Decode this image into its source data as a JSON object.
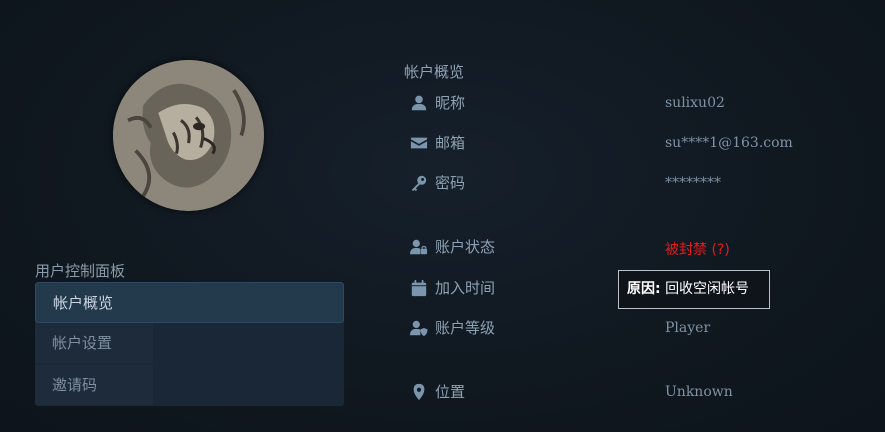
{
  "sidebar": {
    "panel_title": "用户控制面板",
    "items": [
      {
        "label": "帐户概览",
        "active": true
      },
      {
        "label": "帐户设置",
        "active": false
      },
      {
        "label": "邀请码",
        "active": false
      }
    ]
  },
  "account": {
    "section_title": "帐户概览",
    "rows": [
      {
        "icon": "user-icon",
        "label": "昵称",
        "value": "sulixu02"
      },
      {
        "icon": "envelope-icon",
        "label": "邮箱",
        "value": "su****1@163.com"
      },
      {
        "icon": "key-icon",
        "label": "密码",
        "value": "********"
      },
      {
        "icon": "user-lock-icon",
        "label": "账户状态",
        "value": "被封禁 (?)"
      },
      {
        "icon": "calendar-icon",
        "label": "加入时间",
        "value": ""
      },
      {
        "icon": "user-shield-icon",
        "label": "账户等级",
        "value": "Player"
      },
      {
        "icon": "map-marker-icon",
        "label": "位置",
        "value": "Unknown"
      }
    ]
  },
  "tooltip": {
    "prefix": "原因:",
    "text": "回收空闲帐号"
  },
  "colors": {
    "banned": "#e31b1b",
    "icon": "#7b95ad",
    "active_menu_bg": "#23394c"
  }
}
